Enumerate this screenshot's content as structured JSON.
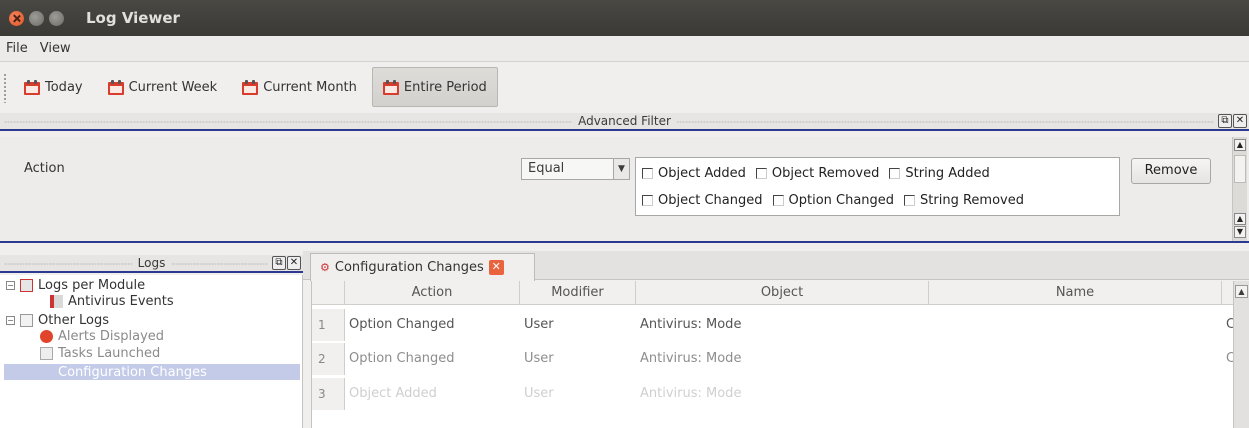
{
  "window": {
    "title": "Log Viewer"
  },
  "menu": [
    "File",
    "View"
  ],
  "toolbar": {
    "buttons": [
      "Today",
      "Current Week",
      "Current Month",
      "Entire Period"
    ],
    "active": "Entire Period"
  },
  "advanced_filter": {
    "header": "Advanced Filter",
    "field_label": "Action",
    "operator": "Equal",
    "checkboxes": [
      "Object Added",
      "Object Removed",
      "String Added",
      "Object Changed",
      "Option Changed",
      "String Removed"
    ],
    "remove_label": "Remove"
  },
  "logs_pane": {
    "header": "Logs",
    "tree": [
      {
        "label": "Logs per Module"
      },
      {
        "label": "Antivirus Events"
      },
      {
        "label": "Other Logs"
      },
      {
        "label": "Alerts Displayed"
      },
      {
        "label": "Tasks Launched"
      },
      {
        "label": "Configuration Changes"
      }
    ],
    "selected": "Configuration Changes"
  },
  "tab": {
    "label": "Configuration Changes"
  },
  "table": {
    "columns": [
      "Action",
      "Modifier",
      "Object",
      "Name"
    ],
    "rows": [
      {
        "num": "1",
        "action": "Option Changed",
        "modifier": "User",
        "object": "Antivirus: Mode",
        "name": "",
        "extra": "C"
      },
      {
        "num": "2",
        "action": "Option Changed",
        "modifier": "User",
        "object": "Antivirus: Mode",
        "name": "",
        "extra": "C"
      },
      {
        "num": "3",
        "action": "Object Added",
        "modifier": "User",
        "object": "Antivirus: Mode",
        "name": "",
        "extra": ""
      }
    ]
  },
  "colors": {
    "accent_bar": "#2b3990",
    "titlebar": "#3c3b37",
    "close_button": "#e0531e",
    "selection": "#c4cbe8"
  },
  "icons": [
    "calendar-icon",
    "close-icon",
    "log-module-icon",
    "antivirus-events-icon",
    "other-logs-icon",
    "alert-icon",
    "tasks-icon",
    "config-changes-icon"
  ]
}
